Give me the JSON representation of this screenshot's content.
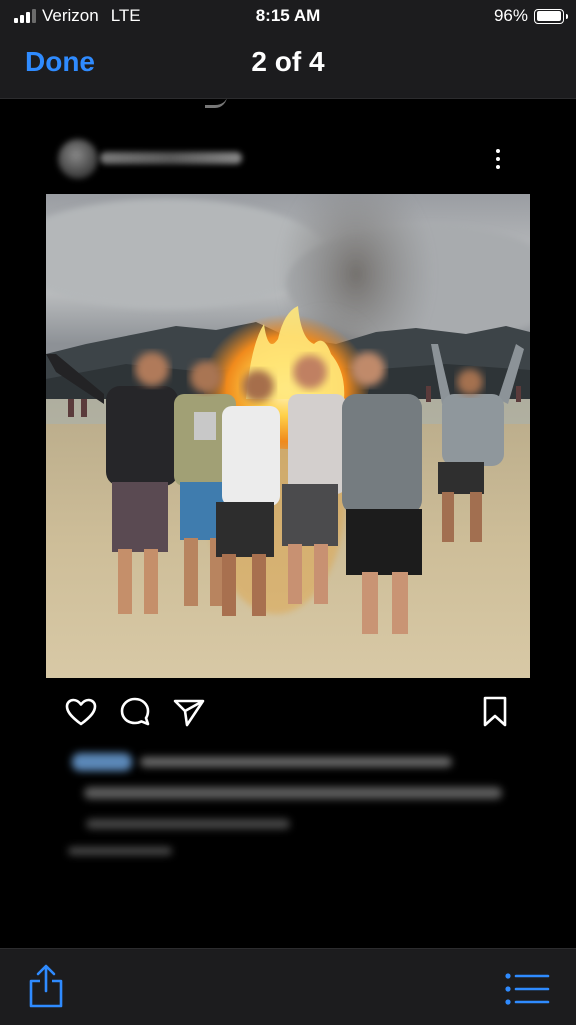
{
  "status_bar": {
    "carrier": "Verizon",
    "network": "LTE",
    "time": "8:15 AM",
    "battery_percent": "96%",
    "battery_level": 0.96,
    "signal_bars": 3
  },
  "nav": {
    "done_label": "Done",
    "title": "2 of 4"
  },
  "post": {
    "username": "",
    "photo_subject": "group of people standing on a beach at dusk in front of a large bonfire, mountains and cloudy sky behind",
    "icons": [
      "heart-icon",
      "comment-icon",
      "send-icon",
      "bookmark-icon"
    ]
  },
  "toolbar": {
    "icons": [
      "share-icon",
      "list-icon"
    ]
  },
  "colors": {
    "accent": "#2f8bff",
    "bar_background": "#1c1c1e",
    "page_background": "#000000"
  }
}
